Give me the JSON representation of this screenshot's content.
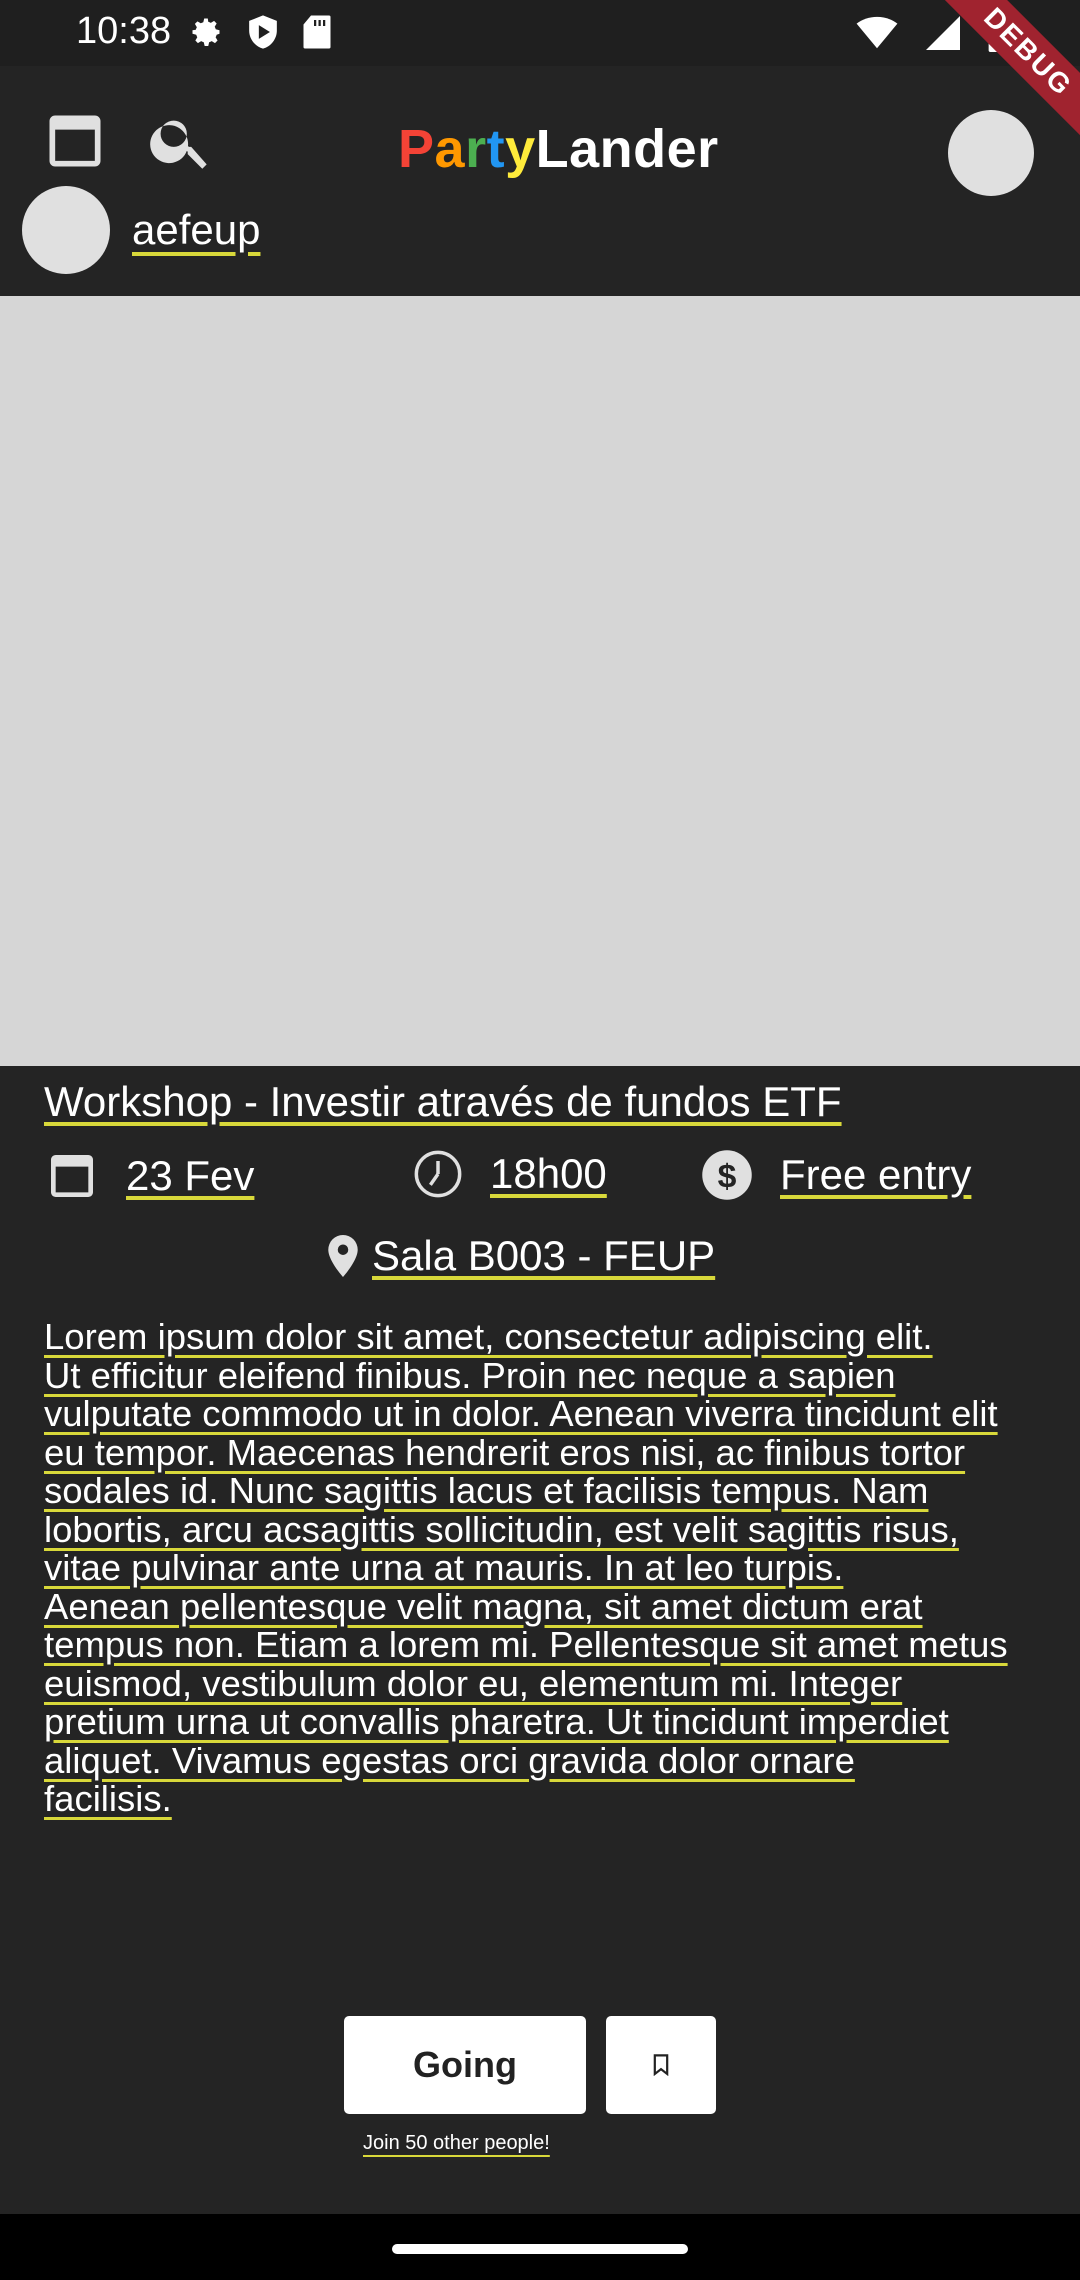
{
  "status_bar": {
    "time": "10:38",
    "icons_left": [
      "settings-icon",
      "play-protect-icon",
      "sd-card-icon"
    ],
    "icons_right": [
      "wifi-icon",
      "signal-icon",
      "battery-icon"
    ]
  },
  "debug_banner": "DEBUG",
  "app_bar": {
    "logo_party": "Party",
    "logo_lander": "Lander",
    "logo_colors": [
      "#f44336",
      "#ff9800",
      "#4caf50",
      "#2196f3",
      "#ffeb3b"
    ],
    "calendar_icon": "calendar-icon",
    "search_icon": "search-icon"
  },
  "organizer": {
    "name": "aefeup"
  },
  "event": {
    "title": "Workshop - Investir através de fundos ETF",
    "date": "23 Fev",
    "time": "18h00",
    "price": "Free entry",
    "location": "Sala B003 - FEUP",
    "description": "Lorem ipsum dolor sit amet, consectetur adipiscing elit.\n Ut efficitur eleifend finibus. Proin nec neque a sapien\n vulputate commodo ut in dolor. Aenean viverra tincidunt elit\n eu tempor. Maecenas hendrerit eros nisi, ac finibus tortor\nsodales id. Nunc sagittis lacus et facilisis tempus. Nam\nlobortis, arcu acsagittis sollicitudin, est velit sagittis risus,\n vitae pulvinar ante urna at mauris. In at leo turpis.\nAenean pellentesque velit magna, sit amet dictum erat\ntempus non. Etiam a lorem mi. Pellentesque sit amet metus\neuismod, vestibulum dolor eu, elementum mi. Integer\npretium urna ut convallis pharetra. Ut tincidunt imperdiet\naliquet. Vivamus egestas orci gravida dolor ornare\nfacilisis."
  },
  "actions": {
    "going_label": "Going",
    "save_icon": "bookmark-icon",
    "join_text": "Join 50 other people!"
  }
}
